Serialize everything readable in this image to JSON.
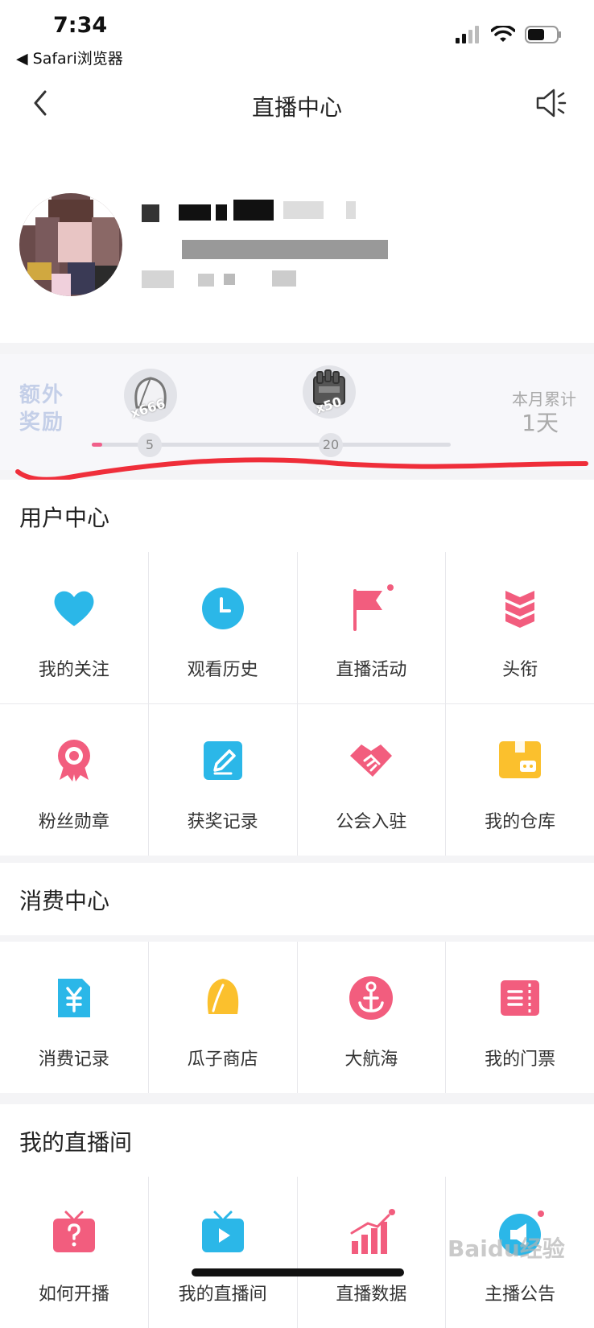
{
  "status": {
    "time": "7:34",
    "back_app": "◀ Safari浏览器"
  },
  "nav": {
    "title": "直播中心"
  },
  "reward": {
    "label_line1": "额外",
    "label_line2": "奖励",
    "milestones": [
      {
        "count": "x666",
        "day": "5"
      },
      {
        "count": "x50",
        "day": "20"
      }
    ],
    "progress_fraction": 0.03,
    "month_label": "本月累计",
    "month_days": "1天"
  },
  "sections": [
    {
      "title": "用户中心",
      "items": [
        {
          "label": "我的关注",
          "icon": "heart-icon"
        },
        {
          "label": "观看历史",
          "icon": "clock-icon"
        },
        {
          "label": "直播活动",
          "icon": "flag-icon"
        },
        {
          "label": "头衔",
          "icon": "chevrons-icon"
        },
        {
          "label": "粉丝勋章",
          "icon": "medal-icon"
        },
        {
          "label": "获奖记录",
          "icon": "pencil-icon"
        },
        {
          "label": "公会入驻",
          "icon": "handshake-icon"
        },
        {
          "label": "我的仓库",
          "icon": "box-icon"
        }
      ]
    },
    {
      "title": "消费中心",
      "items": [
        {
          "label": "消费记录",
          "icon": "yen-icon"
        },
        {
          "label": "瓜子商店",
          "icon": "seed-icon"
        },
        {
          "label": "大航海",
          "icon": "anchor-icon"
        },
        {
          "label": "我的门票",
          "icon": "ticket-icon"
        }
      ]
    },
    {
      "title": "我的直播间",
      "items": [
        {
          "label": "如何开播",
          "icon": "tv-question-icon"
        },
        {
          "label": "我的直播间",
          "icon": "tv-play-icon"
        },
        {
          "label": "直播数据",
          "icon": "chart-icon"
        },
        {
          "label": "主播公告",
          "icon": "megaphone-icon"
        }
      ]
    }
  ],
  "watermark": "Baidu经验"
}
